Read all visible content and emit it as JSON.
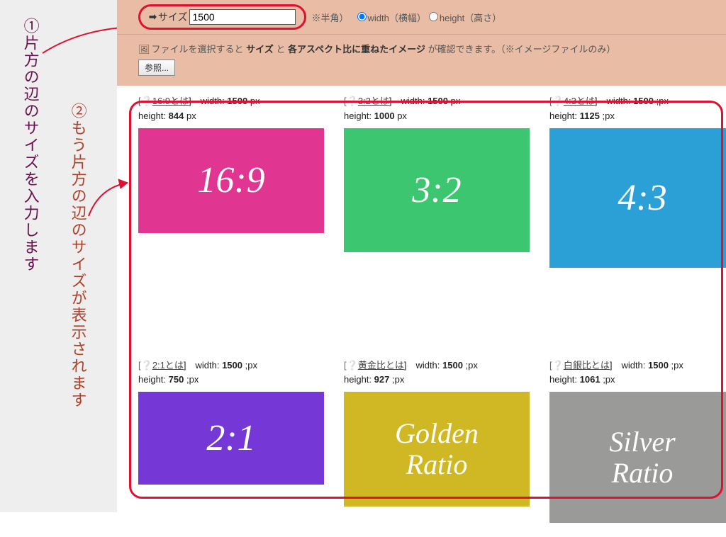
{
  "annotations": {
    "anno1": "①片方の辺のサイズを入力します",
    "anno2": "②もう片方の辺のサイズが表示されます"
  },
  "controls": {
    "size_label": "サイズ",
    "size_value": "1500",
    "half_note": "※半角）",
    "radio_width": "width（横幅）",
    "radio_height": "height（高さ）"
  },
  "file": {
    "prefix": "ファイルを選択すると ",
    "bold1": "サイズ",
    "mid": " と ",
    "bold2": "各アスペクト比に重ねたイメージ",
    "suffix": " が確認できます。（※イメージファイルのみ）",
    "browse": "参照..."
  },
  "cards": [
    {
      "id": "16-9",
      "link": "16:9とは",
      "w": "1500",
      "wu": " px",
      "h": "844",
      "hu": " px",
      "title": "16:9",
      "cls": "t-16-9 tile"
    },
    {
      "id": "3-2",
      "link": "3:2とは",
      "w": "1500",
      "wu": " px",
      "h": "1000",
      "hu": " px",
      "title": "3:2",
      "cls": "t-3-2 tile"
    },
    {
      "id": "4-3",
      "link": "4:3とは",
      "w": "1500",
      "wu": " ;px",
      "h": "1125",
      "hu": " ;px",
      "title": "4:3",
      "cls": "t-4-3 tile"
    },
    {
      "id": "2-1",
      "link": "2:1とは",
      "w": "1500",
      "wu": " ;px",
      "h": "750",
      "hu": " ;px",
      "title": "2:1",
      "cls": "t-2-1 tile"
    },
    {
      "id": "golden",
      "link": "黄金比とは",
      "w": "1500",
      "wu": " ;px",
      "h": "927",
      "hu": " ;px",
      "title": "Golden\nRatio",
      "cls": "t-gold tile small"
    },
    {
      "id": "silver",
      "link": "白銀比とは",
      "w": "1500",
      "wu": " ;px",
      "h": "1061",
      "hu": " ;px",
      "title": "Silver\nRatio",
      "cls": "t-silv tile small"
    }
  ],
  "labels": {
    "width": "width:",
    "height": "height:"
  }
}
